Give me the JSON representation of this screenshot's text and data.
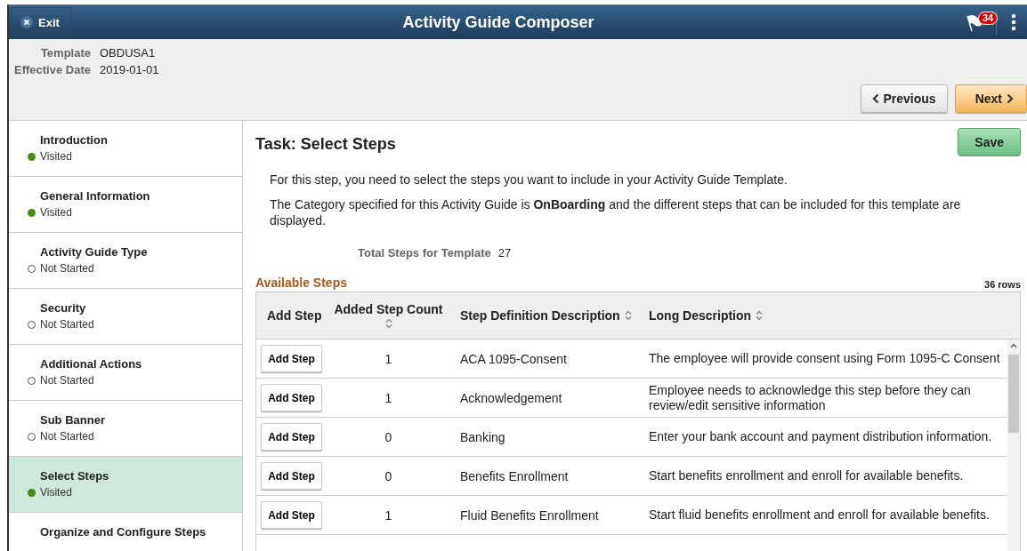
{
  "header": {
    "exit_label": "Exit",
    "title": "Activity Guide Composer",
    "notification_count": "34"
  },
  "info": [
    {
      "label": "Template",
      "value": "OBDUSA1"
    },
    {
      "label": "Effective Date",
      "value": "2019-01-01"
    }
  ],
  "nav_buttons": {
    "previous": "Previous",
    "next": "Next"
  },
  "sidebar": {
    "items": [
      {
        "title": "Introduction",
        "status": "Visited",
        "visited": true,
        "selected": false
      },
      {
        "title": "General Information",
        "status": "Visited",
        "visited": true,
        "selected": false
      },
      {
        "title": "Activity Guide Type",
        "status": "Not Started",
        "visited": false,
        "selected": false
      },
      {
        "title": "Security",
        "status": "Not Started",
        "visited": false,
        "selected": false
      },
      {
        "title": "Additional Actions",
        "status": "Not Started",
        "visited": false,
        "selected": false
      },
      {
        "title": "Sub Banner",
        "status": "Not Started",
        "visited": false,
        "selected": false
      },
      {
        "title": "Select Steps",
        "status": "Visited",
        "visited": true,
        "selected": true
      },
      {
        "title": "Organize and Configure Steps",
        "selected": false
      }
    ]
  },
  "main": {
    "title": "Task: Select Steps",
    "save_label": "Save",
    "paragraphs": [
      "For this step, you need to select the steps you want to include in your Activity Guide Template.",
      "The Category specified for this Activity Guide is **OnBoarding** and the different steps that can be included for this template are displayed."
    ],
    "total_label": "Total Steps for Template",
    "total_value": "27"
  },
  "table": {
    "title": "Available Steps",
    "row_count": "36 rows",
    "columns": [
      {
        "label": "Add Step",
        "sortable": false
      },
      {
        "label": "Added Step Count",
        "sortable": true
      },
      {
        "label": "Step Definition Description",
        "sortable": true
      },
      {
        "label": "Long Description",
        "sortable": true
      }
    ],
    "rows": [
      {
        "button": "Add Step",
        "count": "1",
        "step": "ACA 1095-Consent",
        "description": "The employee will provide consent using Form 1095-C Consent"
      },
      {
        "button": "Add Step",
        "count": "1",
        "step": "Acknowledgement",
        "description": "Employee needs to acknowledge this step before they can review/edit sensitive information"
      },
      {
        "button": "Add Step",
        "count": "0",
        "step": "Banking",
        "description": "Enter your bank account and payment distribution information."
      },
      {
        "button": "Add Step",
        "count": "0",
        "step": "Benefits Enrollment",
        "description": "Start benefits enrollment and enroll for available benefits."
      },
      {
        "button": "Add Step",
        "count": "1",
        "step": "Fluid Benefits Enrollment",
        "description": "Start fluid benefits enrollment and enroll for available benefits."
      }
    ]
  }
}
